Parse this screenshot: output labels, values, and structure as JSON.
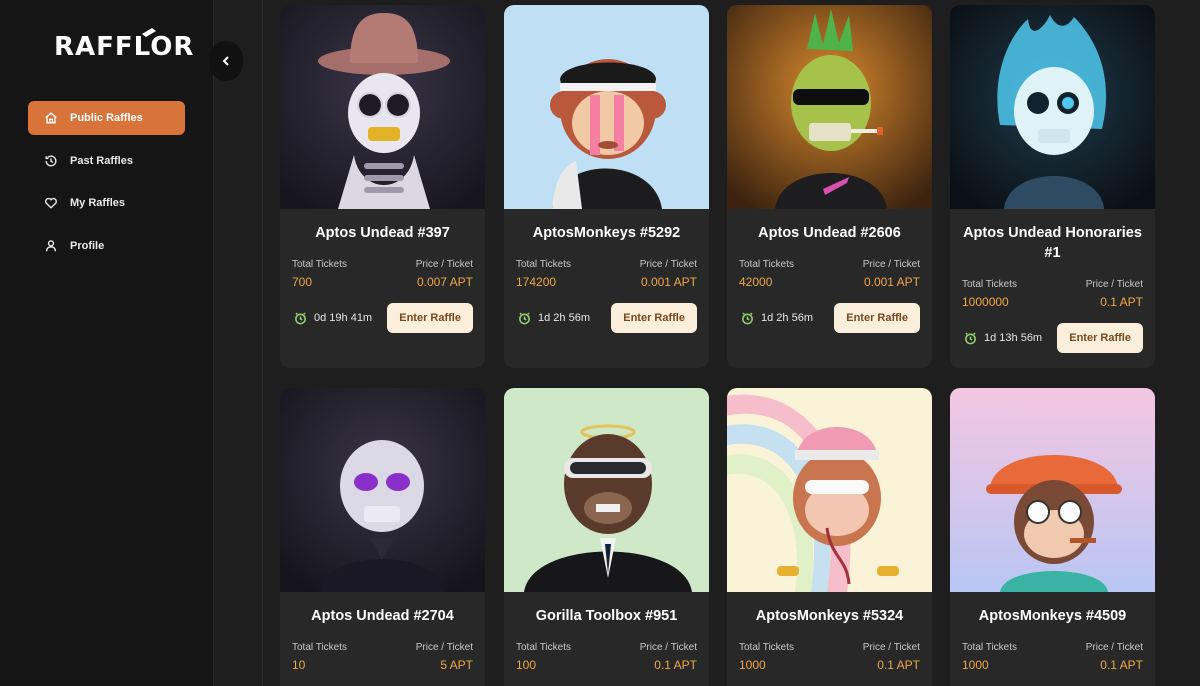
{
  "brand": {
    "name": "RAFFLOR"
  },
  "sidebar": {
    "items": [
      {
        "label": "Public Raffles",
        "icon": "home-icon",
        "active": true
      },
      {
        "label": "Past Raffles",
        "icon": "history-icon",
        "active": false
      },
      {
        "label": "My Raffles",
        "icon": "heart-icon",
        "active": false
      },
      {
        "label": "Profile",
        "icon": "user-icon",
        "active": false
      }
    ]
  },
  "colors": {
    "accent": "#d8733a",
    "price": "#f0a648",
    "button_bg": "#fbeeda",
    "timer_icon": "#8fd16b"
  },
  "labels": {
    "total_tickets": "Total Tickets",
    "price_per_ticket": "Price / Ticket",
    "enter": "Enter Raffle"
  },
  "raffles": [
    {
      "title": "Aptos Undead #397",
      "total": "700",
      "price": "0.007 APT",
      "timer": "0d 19h 41m",
      "art": "skeleton-cowboy"
    },
    {
      "title": "AptosMonkeys #5292",
      "total": "174200",
      "price": "0.001 APT",
      "timer": "1d 2h 56m",
      "art": "monkey-blue"
    },
    {
      "title": "Aptos Undead #2606",
      "total": "42000",
      "price": "0.001 APT",
      "timer": "1d 2h 56m",
      "art": "zombie-green"
    },
    {
      "title": "Aptos Undead Honoraries #1",
      "total": "1000000",
      "price": "0.1 APT",
      "timer": "1d 13h 56m",
      "art": "skull-blue-fire"
    },
    {
      "title": "Aptos Undead #2704",
      "total": "10",
      "price": "5 APT",
      "timer": "",
      "art": "skeleton-suit"
    },
    {
      "title": "Gorilla Toolbox #951",
      "total": "100",
      "price": "0.1 APT",
      "timer": "",
      "art": "gorilla-halo"
    },
    {
      "title": "AptosMonkeys #5324",
      "total": "1000",
      "price": "0.1 APT",
      "timer": "",
      "art": "monkey-rainbow"
    },
    {
      "title": "AptosMonkeys #4509",
      "total": "1000",
      "price": "0.1 APT",
      "timer": "",
      "art": "monkey-doctor"
    }
  ]
}
